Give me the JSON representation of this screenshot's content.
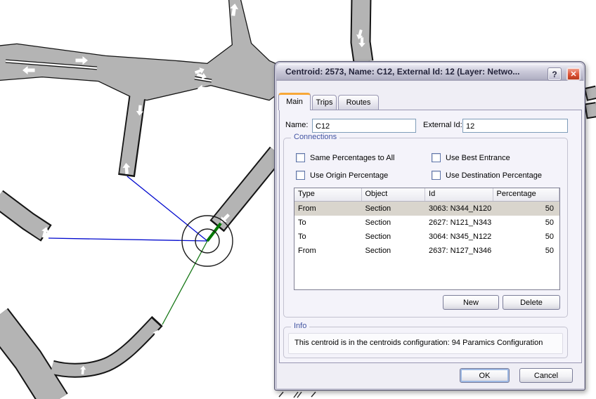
{
  "window": {
    "title": "Centroid: 2573, Name: C12, External Id: 12 (Layer: Netwo...",
    "help_glyph": "?",
    "close_glyph": "✕",
    "tabs": {
      "main": "Main",
      "trips": "Trips",
      "routes": "Routes"
    },
    "fields": {
      "name_label": "Name:",
      "name_value": "C12",
      "external_id_label": "External Id:",
      "external_id_value": "12"
    },
    "connections": {
      "group_label": "Connections",
      "checkboxes": [
        "Same Percentages to All",
        "Use Best Entrance",
        "Use Origin Percentage",
        "Use Destination Percentage"
      ],
      "table": {
        "headers": [
          "Type",
          "Object",
          "Id",
          "Percentage"
        ],
        "rows": [
          {
            "type": "From",
            "object": "Section",
            "id": "3063: N344_N120",
            "percentage": "50"
          },
          {
            "type": "To",
            "object": "Section",
            "id": "2627: N121_N343",
            "percentage": "50"
          },
          {
            "type": "To",
            "object": "Section",
            "id": "3064: N345_N122",
            "percentage": "50"
          },
          {
            "type": "From",
            "object": "Section",
            "id": "2637: N127_N346",
            "percentage": "50"
          }
        ],
        "selected_row_index": 0
      },
      "new_button": "New",
      "delete_button": "Delete"
    },
    "info": {
      "group_label": "Info",
      "text": "This centroid is in the centroids configuration: 94 Paramics Configuration"
    },
    "ok_button": "OK",
    "cancel_button": "Cancel"
  },
  "map": {
    "colors": {
      "road_fill": "#B4B4B4",
      "road_casing": "#141414",
      "arrow_color": "#FFFFFF",
      "conn_blue": "#0008CE",
      "conn_green": "#177817",
      "conn_green_dark": "#007700"
    }
  }
}
